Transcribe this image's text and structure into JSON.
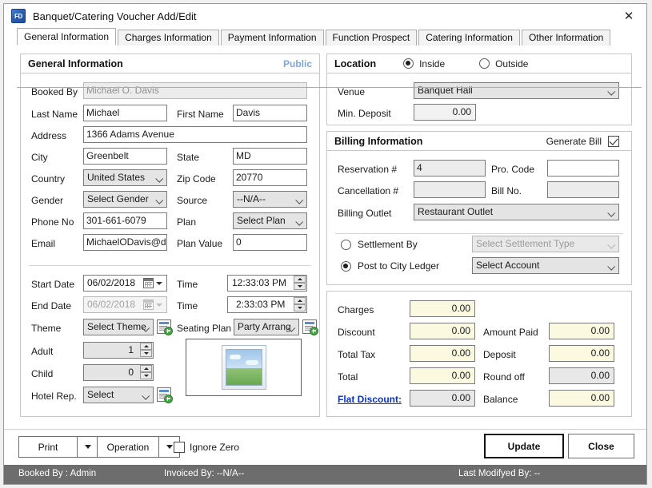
{
  "window": {
    "title": "Banquet/Catering Voucher Add/Edit",
    "app_icon": "fd-app-icon",
    "close_icon": "close-icon"
  },
  "tabs": [
    {
      "label": "General Information",
      "active": true
    },
    {
      "label": "Charges Information",
      "active": false
    },
    {
      "label": "Payment Information",
      "active": false
    },
    {
      "label": "Function Prospect",
      "active": false
    },
    {
      "label": "Catering Information",
      "active": false
    },
    {
      "label": "Other Information",
      "active": false
    }
  ],
  "general": {
    "title": "General Information",
    "public_label": "Public",
    "booked_by_label": "Booked By",
    "booked_by_value": "Michael O. Davis",
    "last_name_label": "Last Name",
    "last_name_value": "Michael",
    "first_name_label": "First Name",
    "first_name_value": "Davis",
    "address_label": "Address",
    "address_value": "1366 Adams Avenue",
    "city_label": "City",
    "city_value": "Greenbelt",
    "state_label": "State",
    "state_value": "MD",
    "country_label": "Country",
    "country_value": "United States",
    "zip_label": "Zip Code",
    "zip_value": "20770",
    "gender_label": "Gender",
    "gender_value": "Select Gender",
    "source_label": "Source",
    "source_value": "--N/A--",
    "phone_label": "Phone No",
    "phone_value": "301-661-6079",
    "plan_label": "Plan",
    "plan_value": "Select Plan",
    "email_label": "Email",
    "email_value": "MichaelODavis@dayr",
    "plan_value_label": "Plan Value",
    "plan_value_value": "0"
  },
  "schedule": {
    "start_date_label": "Start Date",
    "start_date_value": "06/02/2018",
    "start_time_label": "Time",
    "start_time_value": "12:33:03 PM",
    "end_date_label": "End Date",
    "end_date_value": "06/02/2018",
    "end_time_label": "Time",
    "end_time_value": "2:33:03 PM",
    "theme_label": "Theme",
    "theme_value": "Select Theme",
    "seating_plan_label": "Seating Plan",
    "seating_plan_value": "Party Arrang",
    "adult_label": "Adult",
    "adult_value": "1",
    "child_label": "Child",
    "child_value": "0",
    "hotel_rep_label": "Hotel Rep.",
    "hotel_rep_value": "Select"
  },
  "location": {
    "title": "Location",
    "inside_label": "Inside",
    "outside_label": "Outside",
    "selected": "Inside",
    "venue_label": "Venue",
    "venue_value": "Banquet Hall",
    "min_deposit_label": "Min. Deposit",
    "min_deposit_value": "0.00"
  },
  "billing": {
    "title": "Billing Information",
    "generate_bill_label": "Generate Bill",
    "generate_bill_checked": true,
    "reservation_label": "Reservation #",
    "reservation_value": "4",
    "pro_code_label": "Pro. Code",
    "pro_code_value": "",
    "cancellation_label": "Cancellation #",
    "cancellation_value": "",
    "bill_no_label": "Bill No.",
    "bill_no_value": "",
    "billing_outlet_label": "Billing Outlet",
    "billing_outlet_value": "Restaurant Outlet"
  },
  "settlement": {
    "settlement_by_label": "Settlement By",
    "settlement_type_value": "Select Settlement Type",
    "post_to_city_ledger_label": "Post to City Ledger",
    "account_value": "Select Account",
    "selected": "Post to City Ledger"
  },
  "totals": {
    "charges_label": "Charges",
    "charges_value": "0.00",
    "discount_label": "Discount",
    "discount_value": "0.00",
    "amount_paid_label": "Amount Paid",
    "amount_paid_value": "0.00",
    "total_tax_label": "Total Tax",
    "total_tax_value": "0.00",
    "deposit_label": "Deposit",
    "deposit_value": "0.00",
    "total_label": "Total",
    "total_value": "0.00",
    "round_off_label": "Round off",
    "round_off_value": "0.00",
    "flat_discount_label": "Flat Discount:",
    "flat_discount_value": "0.00",
    "balance_label": "Balance",
    "balance_value": "0.00"
  },
  "footer": {
    "print_label": "Print",
    "operation_label": "Operation",
    "ignore_zero_label": "Ignore Zero",
    "ignore_zero_checked": false,
    "update_label": "Update",
    "close_label": "Close"
  },
  "statusbar": {
    "booked_by": "Booked By : Admin",
    "invoiced_by": "Invoiced By: --N/A--",
    "last_modified_by": "Last Modifyed By:  --"
  }
}
